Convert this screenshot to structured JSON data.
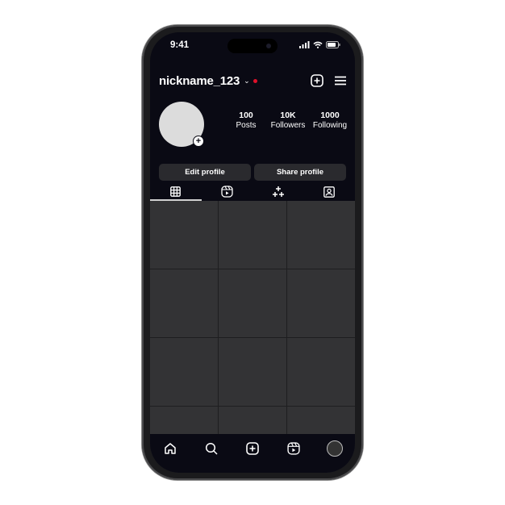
{
  "status_bar": {
    "time": "9:41"
  },
  "header": {
    "username": "nickname_123",
    "new_post_icon": "plus-square-icon",
    "menu_icon": "hamburger-icon"
  },
  "profile": {
    "stats": [
      {
        "value": "100",
        "label": "Posts"
      },
      {
        "value": "10K",
        "label": "Followers"
      },
      {
        "value": "1000",
        "label": "Following"
      }
    ]
  },
  "actions": {
    "edit_label": "Edit profile",
    "share_label": "Share profile"
  },
  "tabs": [
    {
      "name": "grid",
      "icon": "grid-icon",
      "active": true
    },
    {
      "name": "reels",
      "icon": "reels-icon",
      "active": false
    },
    {
      "name": "effects",
      "icon": "sparkles-icon",
      "active": false
    },
    {
      "name": "tagged",
      "icon": "tagged-person-icon",
      "active": false
    }
  ],
  "grid": {
    "cells": 12
  },
  "bottom_nav": [
    {
      "name": "home",
      "icon": "home-icon"
    },
    {
      "name": "search",
      "icon": "search-icon"
    },
    {
      "name": "create",
      "icon": "plus-square-icon"
    },
    {
      "name": "reels",
      "icon": "reels-icon"
    },
    {
      "name": "profile",
      "icon": "avatar-icon"
    }
  ],
  "colors": {
    "background": "#0a0a14",
    "notification_dot": "#e0102a",
    "tile": "#333335",
    "button": "#2a2a2e"
  }
}
